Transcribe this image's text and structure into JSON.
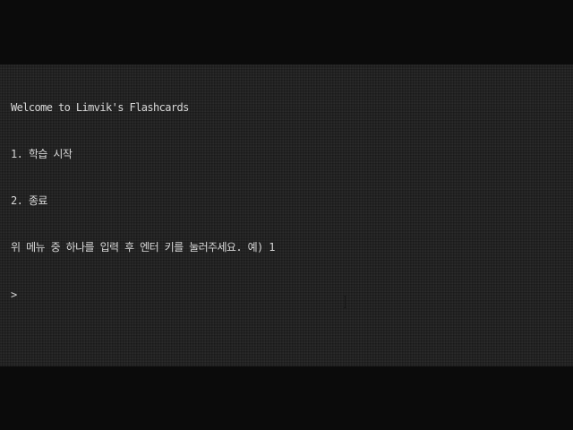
{
  "terminal": {
    "title_line": "Welcome to Limvik's Flashcards",
    "menu": [
      {
        "label": "1. 학습 시작"
      },
      {
        "label": "2. 종료"
      }
    ],
    "instruction": "위 메뉴 중 하나를 입력 후 엔터 키를 눌러주세요. 예) 1",
    "prompt_symbol": ">"
  },
  "colors": {
    "terminal_background": "#232323",
    "text": "#d8d8d8",
    "letterbox": "#0b0b0b"
  },
  "icons": {
    "mouse_cursor": "i-beam-cursor-icon"
  }
}
